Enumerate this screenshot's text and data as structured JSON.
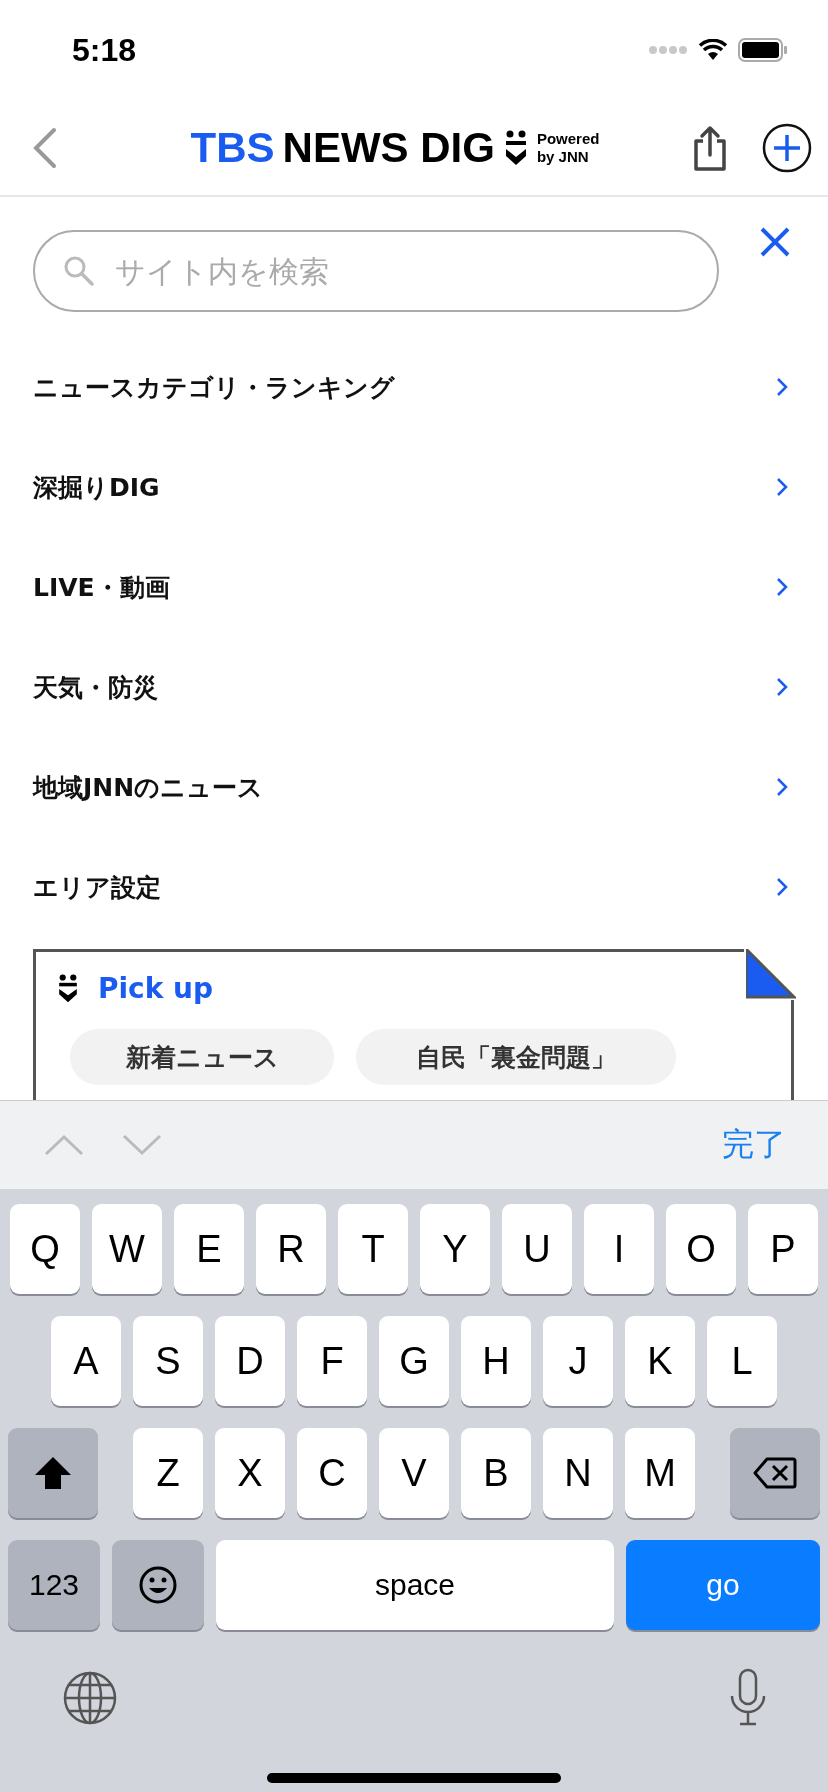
{
  "status_bar": {
    "time": "5:18"
  },
  "header": {
    "logo_blue": "TBS",
    "logo_black": "NEWS DIG",
    "powered_lines": [
      "Powered",
      "by JNN"
    ]
  },
  "search": {
    "placeholder": "サイト内を検索"
  },
  "menu": [
    {
      "label": "ニュースカテゴリ・ランキング"
    },
    {
      "label": "深掘りDIG"
    },
    {
      "label": "LIVE・動画"
    },
    {
      "label": "天気・防災"
    },
    {
      "label": "地域JNNのニュース"
    },
    {
      "label": "エリア設定"
    }
  ],
  "pickup": {
    "title": "Pick up",
    "chips": [
      "新着ニュース",
      "自民「裏金問題」"
    ]
  },
  "toolbar": {
    "done": "完了"
  },
  "keyboard": {
    "rows": [
      [
        "Q",
        "W",
        "E",
        "R",
        "T",
        "Y",
        "U",
        "I",
        "O",
        "P"
      ],
      [
        "A",
        "S",
        "D",
        "F",
        "G",
        "H",
        "J",
        "K",
        "L"
      ],
      [
        "Z",
        "X",
        "C",
        "V",
        "B",
        "N",
        "M"
      ]
    ],
    "numbers_key": "123",
    "space_key": "space",
    "go_key": "go"
  }
}
